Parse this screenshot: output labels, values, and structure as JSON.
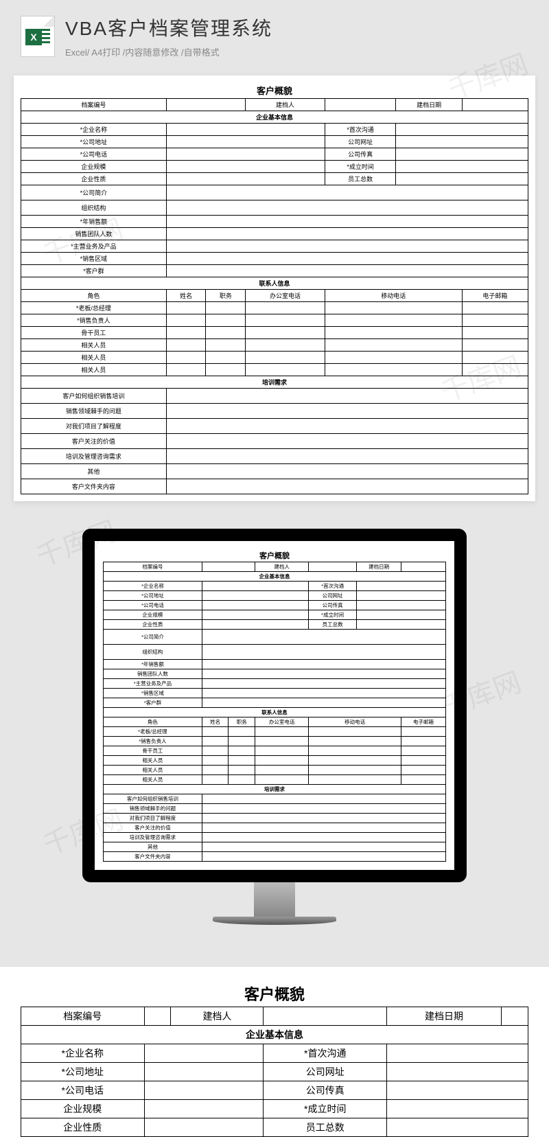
{
  "header": {
    "title": "VBA客户档案管理系统",
    "subtitle": "Excel/ A4打印 /内容随意修改 /自带格式",
    "icon_letter": "X"
  },
  "form": {
    "title": "客户概貌",
    "row1": {
      "file_no": "档案编号",
      "creator": "建档人",
      "date": "建档日期"
    },
    "sec1": "企业基本信息",
    "basic": {
      "l1": "*企业名称",
      "r1": "*首次沟通",
      "l2": "*公司地址",
      "r2": "公司网址",
      "l3": "*公司电话",
      "r3": "公司传真",
      "l4": "企业规模",
      "r4": "*成立时间",
      "l5": "企业性质",
      "r5": "员工总数",
      "l6": "*公司简介",
      "l7": "组织结构",
      "l8": "*年销售额",
      "l9": "销售团队人数",
      "l10": "*主营业务及产品",
      "l11": "*销售区域",
      "l12": "*客户群"
    },
    "sec2": "联系人信息",
    "contact_h": [
      "角色",
      "姓名",
      "职务",
      "办公室电话",
      "移动电话",
      "电子邮箱"
    ],
    "contact_r": [
      "*老板/总经理",
      "*销售负责人",
      "骨干员工",
      "相关人员",
      "相关人员",
      "相关人员"
    ],
    "sec3": "培训需求",
    "train": [
      "客户如何组织销售培训",
      "销售领域棘手的问题",
      "对我们项目了解程度",
      "客户关注的价值",
      "培训及管理咨询需求",
      "其他",
      "客户文件夹内容"
    ]
  },
  "watermark": "千库网"
}
